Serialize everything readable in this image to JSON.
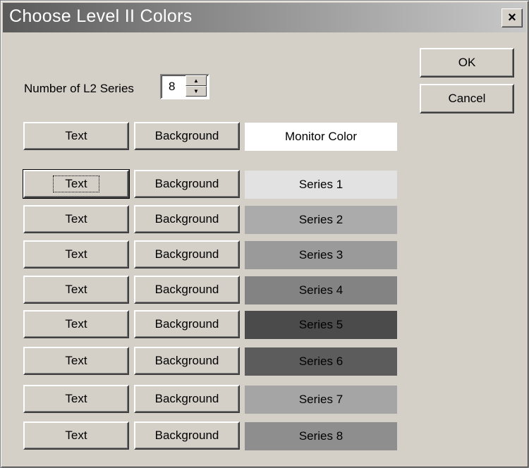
{
  "dialog": {
    "title": "Choose Level II Colors",
    "close_label": "×"
  },
  "buttons": {
    "ok": "OK",
    "cancel": "Cancel"
  },
  "series_count": {
    "label": "Number of L2 Series",
    "value": "8"
  },
  "monitor": {
    "text_label": "Text",
    "background_label": "Background",
    "swatch_label": "Monitor Color",
    "swatch_bg": "#ffffff",
    "swatch_fg": "#000000"
  },
  "series": [
    {
      "text_label": "Text",
      "background_label": "Background",
      "name": "Series 1",
      "bg": "#e2e2e2",
      "fg": "#000000"
    },
    {
      "text_label": "Text",
      "background_label": "Background",
      "name": "Series 2",
      "bg": "#ababab",
      "fg": "#000000"
    },
    {
      "text_label": "Text",
      "background_label": "Background",
      "name": "Series 3",
      "bg": "#9a9a9a",
      "fg": "#000000"
    },
    {
      "text_label": "Text",
      "background_label": "Background",
      "name": "Series 4",
      "bg": "#838383",
      "fg": "#000000"
    },
    {
      "text_label": "Text",
      "background_label": "Background",
      "name": "Series 5",
      "bg": "#4b4b4b",
      "fg": "#000000"
    },
    {
      "text_label": "Text",
      "background_label": "Background",
      "name": "Series 6",
      "bg": "#5c5c5c",
      "fg": "#000000"
    },
    {
      "text_label": "Text",
      "background_label": "Background",
      "name": "Series 7",
      "bg": "#a5a5a5",
      "fg": "#000000"
    },
    {
      "text_label": "Text",
      "background_label": "Background",
      "name": "Series 8",
      "bg": "#8e8e8e",
      "fg": "#000000"
    }
  ]
}
